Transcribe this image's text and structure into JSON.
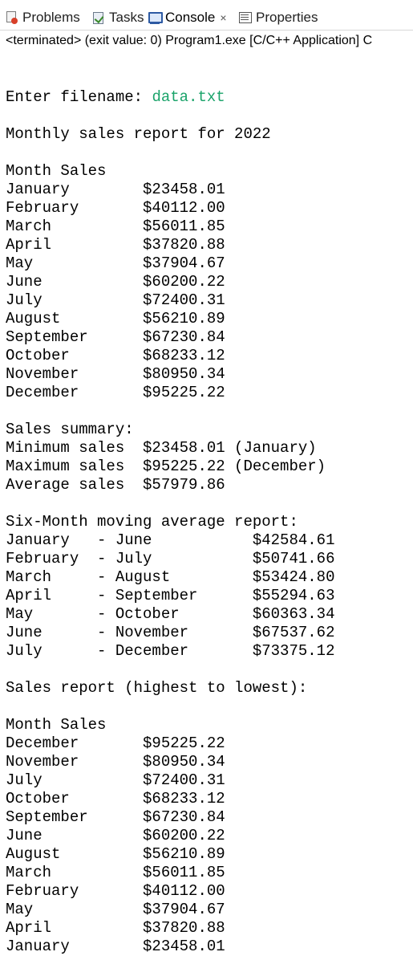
{
  "tabs": [
    {
      "label": "Problems",
      "icon": "problems-icon"
    },
    {
      "label": "Tasks",
      "icon": "tasks-icon"
    },
    {
      "label": "Console",
      "icon": "console-icon",
      "active": true,
      "close": "×"
    },
    {
      "label": "Properties",
      "icon": "properties-icon"
    }
  ],
  "status": "<terminated> (exit value: 0) Program1.exe [C/C++ Application] C",
  "colors": {
    "input_text": "#1aa36a"
  },
  "console": {
    "prompt": "Enter filename: ",
    "input": "data.txt",
    "lines": [
      "Monthly sales report for 2022",
      "",
      "Month Sales",
      "January        $23458.01",
      "February       $40112.00",
      "March          $56011.85",
      "April          $37820.88",
      "May            $37904.67",
      "June           $60200.22",
      "July           $72400.31",
      "August         $56210.89",
      "September      $67230.84",
      "October        $68233.12",
      "November       $80950.34",
      "December       $95225.22",
      "",
      "Sales summary:",
      "Minimum sales  $23458.01 (January)",
      "Maximum sales  $95225.22 (December)",
      "Average sales  $57979.86",
      "",
      "Six-Month moving average report:",
      "January   - June           $42584.61",
      "February  - July           $50741.66",
      "March     - August         $53424.80",
      "April     - September      $55294.63",
      "May       - October        $60363.34",
      "June      - November       $67537.62",
      "July      - December       $73375.12",
      "",
      "Sales report (highest to lowest):",
      "",
      "Month Sales",
      "December       $95225.22",
      "November       $80950.34",
      "July           $72400.31",
      "October        $68233.12",
      "September      $67230.84",
      "June           $60200.22",
      "August         $56210.89",
      "March          $56011.85",
      "February       $40112.00",
      "May            $37904.67",
      "April          $37820.88",
      "January        $23458.01"
    ]
  }
}
